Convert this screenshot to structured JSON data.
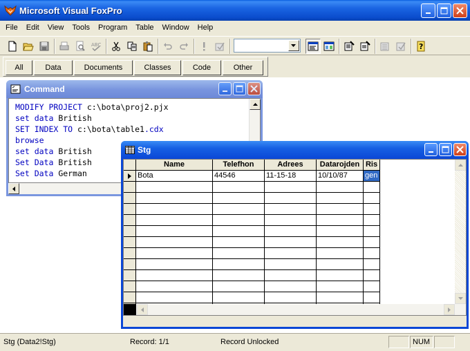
{
  "app": {
    "title": "Microsoft Visual FoxPro"
  },
  "menu": [
    "File",
    "Edit",
    "View",
    "Tools",
    "Program",
    "Table",
    "Window",
    "Help"
  ],
  "toolbar": {
    "icons": [
      "new-file-icon",
      "open-folder-icon",
      "save-icon",
      "print-icon",
      "print-preview-icon",
      "spelling-icon",
      "cut-icon",
      "copy-icon",
      "paste-icon",
      "undo-icon",
      "redo-icon",
      "run-icon",
      "modify-form-icon",
      "database-dropdown",
      "command-window-icon",
      "view-window-icon",
      "form-wizard-icon",
      "report-wizard-icon",
      "autoform-icon",
      "autoreport-icon",
      "help-icon"
    ],
    "database_combo_value": ""
  },
  "project_tabs": [
    "All",
    "Data",
    "Documents",
    "Classes",
    "Code",
    "Other"
  ],
  "command_window": {
    "title": "Command",
    "lines": [
      {
        "kw": "MODIFY PROJECT",
        "rest": " c:\\bota\\proj2.pjx"
      },
      {
        "kw": "set data",
        "rest": " British"
      },
      {
        "kw": "SET INDEX TO",
        "rest": " c:\\bota\\table1",
        "ext": ".cdx"
      },
      {
        "kw": "browse",
        "rest": ""
      },
      {
        "kw": "set data",
        "rest": " British"
      },
      {
        "kw": "Set Data",
        "rest": " British"
      },
      {
        "kw": "Set Data",
        "rest": " German"
      }
    ]
  },
  "browse_window": {
    "title": "Stg",
    "columns": [
      "Name",
      "Telefhon",
      "Adrees",
      "Datarojden",
      "Ris"
    ],
    "rows": [
      [
        "Bota",
        "44546",
        "11-15-18",
        "10/10/87",
        "gen"
      ]
    ]
  },
  "status": {
    "alias": "Stg (Data2!Stg)",
    "record": "Record: 1/1",
    "lock": "Record Unlocked",
    "num": "NUM"
  },
  "colors": {
    "title_active": "#0b47d6",
    "title_inactive": "#7a96df",
    "keyword": "#0000c0",
    "selection": "#316ac5"
  }
}
